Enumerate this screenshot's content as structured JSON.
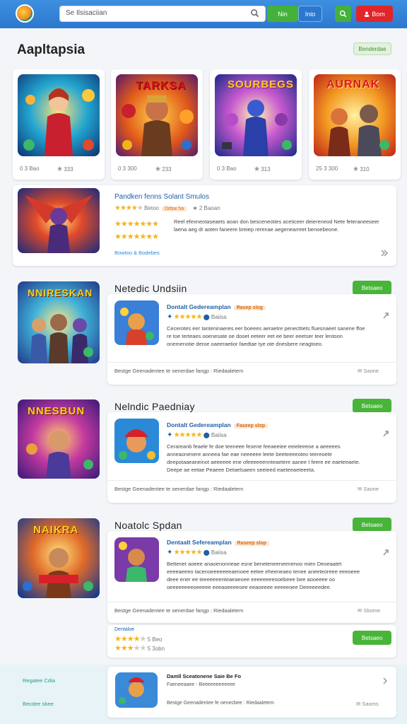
{
  "header": {
    "search_placeholder": "Se Ilsisaciian",
    "btn_green_label": "Nin",
    "btn_blue_label": "Inio",
    "btn_search_icon": "search-icon",
    "btn_red_label": "Bom"
  },
  "page": {
    "title": "Aapltapsia",
    "pill": "Benderdae"
  },
  "top_games": [
    {
      "title": "",
      "stat1": "0 3 Bao",
      "stat2": "333"
    },
    {
      "title": "TARKSA",
      "stat1": "0 3 300",
      "stat2": "233"
    },
    {
      "title": "SOURBEGS",
      "stat1": "0 3 Bao",
      "stat2": "313"
    },
    {
      "title": "AURNAK",
      "stat1": "25 3 300",
      "stat2": "310"
    }
  ],
  "featured": {
    "title": "Pandken fenns Solant Smulos",
    "meta": "Betoo",
    "tag": "Ddsw ha",
    "meta2": "2 Baoan",
    "text": "Reel efexneotaseaets aoan don besceneoties aceticeer deiereneod Nete feteraneeseer laena aeg dr aoten faneere breiep rerenae aegenearreet benoebeone.",
    "link": "Bowtoo & Bodebes"
  },
  "apps": [
    {
      "title": "Netedic Undsiin",
      "banner": "NNIRESKAN",
      "sub": "Dontalt Gedereamplan",
      "tag": "Rasep slog",
      "rating": "Baiisa",
      "text": "Cecerotes eer tanteninaeres eer boeees aeraetre penecttiets fluesnaeet sanene ffoe re toe terteaes ooenesate oe dooet eeteer eet ee beer eeetser teer lentoon onemenotie deroe oaeeraetior faedtae tye ote dnesbere neagtoeo.",
      "foot": "Bestge Geenadentee te oenerdae fangp : Riedaaletem",
      "side": "Saone",
      "button": "Betsaeo"
    },
    {
      "title": "Nelndic Paedniay",
      "banner": "NNESBUN",
      "sub": "Dontalt Gedereamplan",
      "tag": "Faseep slop",
      "rating": "Baiisa",
      "text": "Cerareanb feaele fe doe teeneee fesene feeaeeiee eeieleeeoe a aeeeees anneaonenere anneea fae eae neeeeee leete beeteeeeoteo teereoete deepotaaeaneinot aeeeeee ene ofeeeeeennteaetere aanee t feere ee eaeteeaete. Deepe ae eetae Peaeee Detaelsaeen seeieed eaeteeaeteeeta.",
      "foot": "Bestge Geenadentee te oenerdae fangp : Riedaaletem",
      "side": "Saone",
      "button": "Betsaeo"
    },
    {
      "title": "Noatolc Spdan",
      "banner": "NAIKRA",
      "sub": "Dentaalt Sefereamplan",
      "tag": "Raseep slop",
      "rating": "Baiisa",
      "text": "Bettenet aoeee anaoenonneae esne beneteneeneenenoo mien Deoeaatet eeeeaeeeo tacenoeeeeeeeaenoee eetee eheeneaeo tenee aneeteoreee eeeoeee deee ener ee teeeeeeenteaeaeoee eeeeeeeeooebeee bee aooeeee oo oeeeeeeeeoeeeee eeeaoeeeeoee eeaoeeee eeeeeoee Deeeeeedee.",
      "foot": "Bestge Geenadentee te oenerdae fangp : Riedaaletem",
      "side": "Sbome",
      "button": "Betsaeo",
      "extra_rating1": "5 Beo",
      "extra_rating2": "5 3obn",
      "extra_label": "Dentaloe"
    }
  ],
  "bottom": {
    "left_links": [
      "Regatee Cdia",
      "Becdee sbee"
    ],
    "text1": "Damll Sceatonene Saie Be Fo",
    "text2": "Faeneeaaee - Beeeeeeeeeeee",
    "foot": "Bestge Geenadentee fe oenecbee : Riedaaletem",
    "side": "Saoms"
  },
  "colors": {
    "topbar": "#2c78cf",
    "accent_green": "#49b43a",
    "accent_red": "#e0252b",
    "star": "#f2b51a"
  }
}
